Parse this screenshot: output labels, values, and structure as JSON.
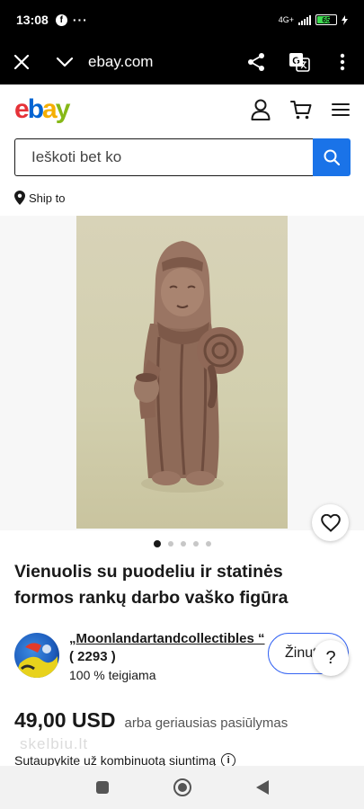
{
  "status_bar": {
    "time": "13:08",
    "fb_glyph": "f",
    "dots": "···",
    "network": "4G+",
    "battery": "65"
  },
  "browser": {
    "url": "ebay.com",
    "icons": [
      "close-icon",
      "chevron-down-icon",
      "share-icon",
      "translate-icon",
      "more-vert-icon"
    ]
  },
  "header": {
    "logo": {
      "e": "e",
      "b": "b",
      "a": "a",
      "y": "y"
    },
    "icons": [
      "account-icon",
      "cart-icon",
      "menu-icon"
    ]
  },
  "search": {
    "placeholder": "Ieškoti bet ko",
    "button_icon": "search-icon",
    "button_color": "#1a73e8"
  },
  "ship_to": {
    "label": "Ship to"
  },
  "carousel": {
    "count": 5,
    "active": 0
  },
  "item": {
    "title": "Vienuolis su puodeliu ir statinės formos rankų darbo vaško figūra"
  },
  "seller": {
    "name": "„Moonlandartandcollectibles “",
    "count": "( 2293 )",
    "feedback": "100 % teigiama",
    "message_button": "Žinutė"
  },
  "help": {
    "label": "?"
  },
  "price": {
    "value": "49,00 USD",
    "alt": "arba geriausias pasiūlymas"
  },
  "watermark": {
    "text": "skelbiu.lt"
  },
  "shipping": {
    "note": "Sutaupykite už kombinuotą siuntimą"
  },
  "colors": {
    "accent_blue": "#3665f3",
    "search_blue": "#1a73e8"
  }
}
